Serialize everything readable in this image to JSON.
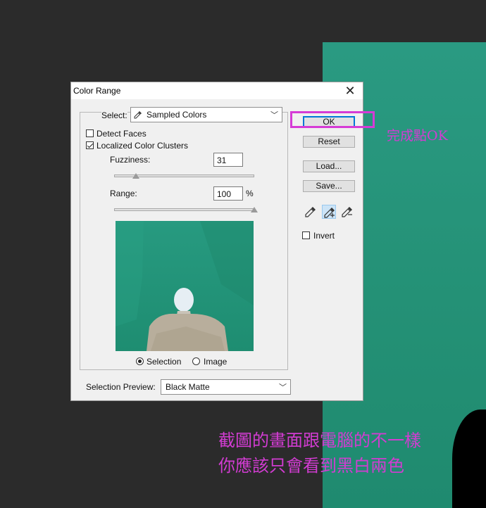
{
  "dialog": {
    "title": "Color Range",
    "select": {
      "label": "Select:",
      "value": "Sampled Colors"
    },
    "detect_faces": {
      "label": "Detect Faces",
      "checked": false
    },
    "localized_clusters": {
      "label": "Localized Color Clusters",
      "checked": true
    },
    "fuzziness": {
      "label": "Fuzziness:",
      "value": "31",
      "level": 31,
      "max": 200
    },
    "range": {
      "label": "Range:",
      "value": "100",
      "unit": "%",
      "level": 100
    },
    "view": {
      "selection_label": "Selection",
      "image_label": "Image",
      "selected": "Selection"
    },
    "selection_preview": {
      "label": "Selection Preview:",
      "value": "Black Matte"
    },
    "buttons": {
      "ok": "OK",
      "reset": "Reset",
      "load": "Load...",
      "save": "Save..."
    },
    "invert": {
      "label": "Invert",
      "checked": false
    }
  },
  "annotations": {
    "ok_note": "完成點OK",
    "note_line1": "截圖的畫面跟電腦的不一樣",
    "note_line2": "你應該只會看到黑白兩色"
  },
  "colors": {
    "canvas_green": "#249176",
    "annotation": "#d23cd2",
    "ok_border": "#0078d7"
  }
}
